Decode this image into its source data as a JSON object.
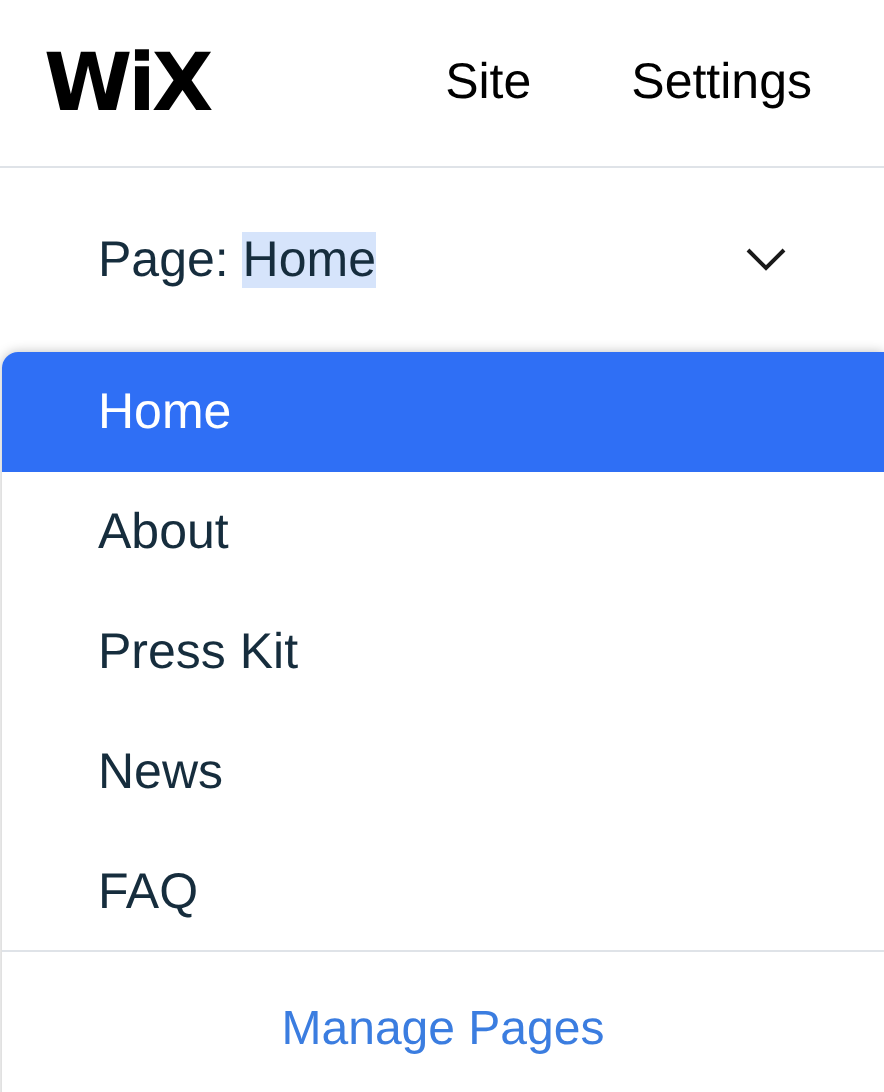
{
  "logo": "WiX",
  "nav": [
    {
      "label": "Site"
    },
    {
      "label": "Settings"
    }
  ],
  "page_selector": {
    "label": "Page:",
    "value": "Home",
    "value_highlighted": true
  },
  "pages": [
    {
      "label": "Home",
      "selected": true
    },
    {
      "label": "About",
      "selected": false
    },
    {
      "label": "Press Kit",
      "selected": false
    },
    {
      "label": "News",
      "selected": false
    },
    {
      "label": "FAQ",
      "selected": false
    }
  ],
  "footer_link": "Manage Pages"
}
